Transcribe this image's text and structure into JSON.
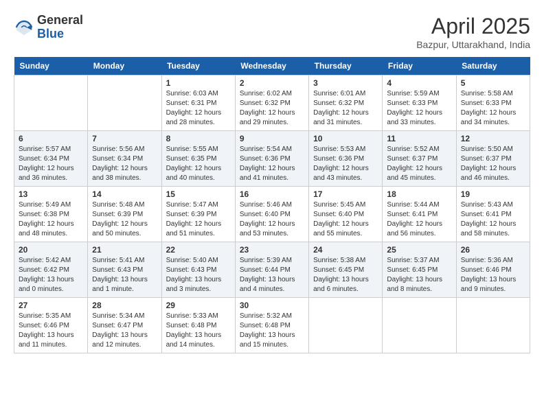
{
  "header": {
    "logo_general": "General",
    "logo_blue": "Blue",
    "month_title": "April 2025",
    "location": "Bazpur, Uttarakhand, India"
  },
  "days_of_week": [
    "Sunday",
    "Monday",
    "Tuesday",
    "Wednesday",
    "Thursday",
    "Friday",
    "Saturday"
  ],
  "weeks": [
    [
      {
        "day": "",
        "info": ""
      },
      {
        "day": "",
        "info": ""
      },
      {
        "day": "1",
        "info": "Sunrise: 6:03 AM\nSunset: 6:31 PM\nDaylight: 12 hours\nand 28 minutes."
      },
      {
        "day": "2",
        "info": "Sunrise: 6:02 AM\nSunset: 6:32 PM\nDaylight: 12 hours\nand 29 minutes."
      },
      {
        "day": "3",
        "info": "Sunrise: 6:01 AM\nSunset: 6:32 PM\nDaylight: 12 hours\nand 31 minutes."
      },
      {
        "day": "4",
        "info": "Sunrise: 5:59 AM\nSunset: 6:33 PM\nDaylight: 12 hours\nand 33 minutes."
      },
      {
        "day": "5",
        "info": "Sunrise: 5:58 AM\nSunset: 6:33 PM\nDaylight: 12 hours\nand 34 minutes."
      }
    ],
    [
      {
        "day": "6",
        "info": "Sunrise: 5:57 AM\nSunset: 6:34 PM\nDaylight: 12 hours\nand 36 minutes."
      },
      {
        "day": "7",
        "info": "Sunrise: 5:56 AM\nSunset: 6:34 PM\nDaylight: 12 hours\nand 38 minutes."
      },
      {
        "day": "8",
        "info": "Sunrise: 5:55 AM\nSunset: 6:35 PM\nDaylight: 12 hours\nand 40 minutes."
      },
      {
        "day": "9",
        "info": "Sunrise: 5:54 AM\nSunset: 6:36 PM\nDaylight: 12 hours\nand 41 minutes."
      },
      {
        "day": "10",
        "info": "Sunrise: 5:53 AM\nSunset: 6:36 PM\nDaylight: 12 hours\nand 43 minutes."
      },
      {
        "day": "11",
        "info": "Sunrise: 5:52 AM\nSunset: 6:37 PM\nDaylight: 12 hours\nand 45 minutes."
      },
      {
        "day": "12",
        "info": "Sunrise: 5:50 AM\nSunset: 6:37 PM\nDaylight: 12 hours\nand 46 minutes."
      }
    ],
    [
      {
        "day": "13",
        "info": "Sunrise: 5:49 AM\nSunset: 6:38 PM\nDaylight: 12 hours\nand 48 minutes."
      },
      {
        "day": "14",
        "info": "Sunrise: 5:48 AM\nSunset: 6:39 PM\nDaylight: 12 hours\nand 50 minutes."
      },
      {
        "day": "15",
        "info": "Sunrise: 5:47 AM\nSunset: 6:39 PM\nDaylight: 12 hours\nand 51 minutes."
      },
      {
        "day": "16",
        "info": "Sunrise: 5:46 AM\nSunset: 6:40 PM\nDaylight: 12 hours\nand 53 minutes."
      },
      {
        "day": "17",
        "info": "Sunrise: 5:45 AM\nSunset: 6:40 PM\nDaylight: 12 hours\nand 55 minutes."
      },
      {
        "day": "18",
        "info": "Sunrise: 5:44 AM\nSunset: 6:41 PM\nDaylight: 12 hours\nand 56 minutes."
      },
      {
        "day": "19",
        "info": "Sunrise: 5:43 AM\nSunset: 6:41 PM\nDaylight: 12 hours\nand 58 minutes."
      }
    ],
    [
      {
        "day": "20",
        "info": "Sunrise: 5:42 AM\nSunset: 6:42 PM\nDaylight: 13 hours\nand 0 minutes."
      },
      {
        "day": "21",
        "info": "Sunrise: 5:41 AM\nSunset: 6:43 PM\nDaylight: 13 hours\nand 1 minute."
      },
      {
        "day": "22",
        "info": "Sunrise: 5:40 AM\nSunset: 6:43 PM\nDaylight: 13 hours\nand 3 minutes."
      },
      {
        "day": "23",
        "info": "Sunrise: 5:39 AM\nSunset: 6:44 PM\nDaylight: 13 hours\nand 4 minutes."
      },
      {
        "day": "24",
        "info": "Sunrise: 5:38 AM\nSunset: 6:45 PM\nDaylight: 13 hours\nand 6 minutes."
      },
      {
        "day": "25",
        "info": "Sunrise: 5:37 AM\nSunset: 6:45 PM\nDaylight: 13 hours\nand 8 minutes."
      },
      {
        "day": "26",
        "info": "Sunrise: 5:36 AM\nSunset: 6:46 PM\nDaylight: 13 hours\nand 9 minutes."
      }
    ],
    [
      {
        "day": "27",
        "info": "Sunrise: 5:35 AM\nSunset: 6:46 PM\nDaylight: 13 hours\nand 11 minutes."
      },
      {
        "day": "28",
        "info": "Sunrise: 5:34 AM\nSunset: 6:47 PM\nDaylight: 13 hours\nand 12 minutes."
      },
      {
        "day": "29",
        "info": "Sunrise: 5:33 AM\nSunset: 6:48 PM\nDaylight: 13 hours\nand 14 minutes."
      },
      {
        "day": "30",
        "info": "Sunrise: 5:32 AM\nSunset: 6:48 PM\nDaylight: 13 hours\nand 15 minutes."
      },
      {
        "day": "",
        "info": ""
      },
      {
        "day": "",
        "info": ""
      },
      {
        "day": "",
        "info": ""
      }
    ]
  ]
}
